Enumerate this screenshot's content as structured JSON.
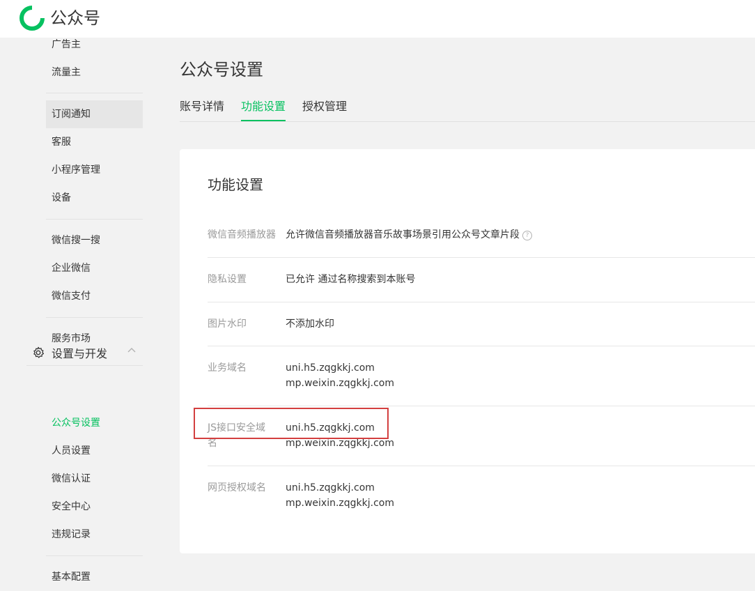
{
  "header": {
    "brand": "公众号"
  },
  "sidebar": {
    "items": [
      {
        "label": "广告主"
      },
      {
        "label": "流量主"
      },
      {
        "label": "订阅通知"
      },
      {
        "label": "客服"
      },
      {
        "label": "小程序管理"
      },
      {
        "label": "设备"
      },
      {
        "label": "微信搜一搜"
      },
      {
        "label": "企业微信"
      },
      {
        "label": "微信支付"
      },
      {
        "label": "服务市场"
      }
    ],
    "section": {
      "label": "设置与开发"
    },
    "sub_items": [
      {
        "label": "公众号设置"
      },
      {
        "label": "人员设置"
      },
      {
        "label": "微信认证"
      },
      {
        "label": "安全中心"
      },
      {
        "label": "违规记录"
      },
      {
        "label": "基本配置"
      }
    ]
  },
  "main": {
    "title": "公众号设置",
    "tabs": [
      {
        "label": "账号详情"
      },
      {
        "label": "功能设置"
      },
      {
        "label": "授权管理"
      }
    ],
    "card_title": "功能设置",
    "rows": [
      {
        "label": "微信音频播放器",
        "values": [
          "允许微信音频播放器音乐故事场景引用公众号文章片段"
        ]
      },
      {
        "label": "隐私设置",
        "values": [
          "已允许 通过名称搜索到本账号"
        ]
      },
      {
        "label": "图片水印",
        "values": [
          "不添加水印"
        ]
      },
      {
        "label": "业务域名",
        "values": [
          "uni.h5.zqgkkj.com",
          "mp.weixin.zqgkkj.com"
        ]
      },
      {
        "label_line1": "JS接口安全域",
        "label_line2": "名",
        "values": [
          "uni.h5.zqgkkj.com",
          "mp.weixin.zqgkkj.com"
        ]
      },
      {
        "label": "网页授权域名",
        "values": [
          "uni.h5.zqgkkj.com",
          "mp.weixin.zqgkkj.com"
        ]
      }
    ],
    "help_glyph": "?"
  },
  "colors": {
    "accent": "#07c160",
    "highlight_box": "#d33f3f"
  }
}
